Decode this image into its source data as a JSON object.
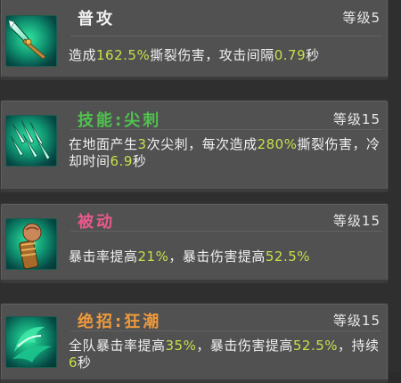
{
  "skills": [
    {
      "name": "普攻",
      "name_color": "#f2f2f2",
      "level": "等级5",
      "icon": "spear-blade-icon",
      "desc": [
        {
          "t": "造成"
        },
        {
          "t": "162.5%",
          "hl": true
        },
        {
          "t": "撕裂伤害，攻击间隔"
        },
        {
          "t": "0.79",
          "hl": true
        },
        {
          "t": "秒"
        }
      ]
    },
    {
      "name": "技能:尖刺",
      "name_color": "#4fc24f",
      "level": "等级15",
      "icon": "spikes-icon",
      "desc": [
        {
          "t": "在地面产生"
        },
        {
          "t": "3",
          "hl": true
        },
        {
          "t": "次尖刺，每次造成"
        },
        {
          "t": "280%",
          "hl": true
        },
        {
          "t": "撕裂伤害，冷却时间"
        },
        {
          "t": "6.9",
          "hl": true
        },
        {
          "t": "秒"
        }
      ]
    },
    {
      "name": "被动",
      "name_color": "#e85a8c",
      "level": "等级15",
      "icon": "fist-icon",
      "desc": [
        {
          "t": "暴击率提高"
        },
        {
          "t": "21%",
          "hl": true
        },
        {
          "t": "，暴击伤害提高"
        },
        {
          "t": "52.5%",
          "hl": true
        }
      ]
    },
    {
      "name": "绝招:狂潮",
      "name_color": "#ef9a3c",
      "level": "等级15",
      "icon": "frenzy-icon",
      "desc": [
        {
          "t": "全队暴击率提高"
        },
        {
          "t": "35%",
          "hl": true
        },
        {
          "t": "，暴击伤害提高"
        },
        {
          "t": "52.5%",
          "hl": true
        },
        {
          "t": "，持续"
        },
        {
          "t": "6",
          "hl": true
        },
        {
          "t": "秒"
        }
      ]
    }
  ]
}
